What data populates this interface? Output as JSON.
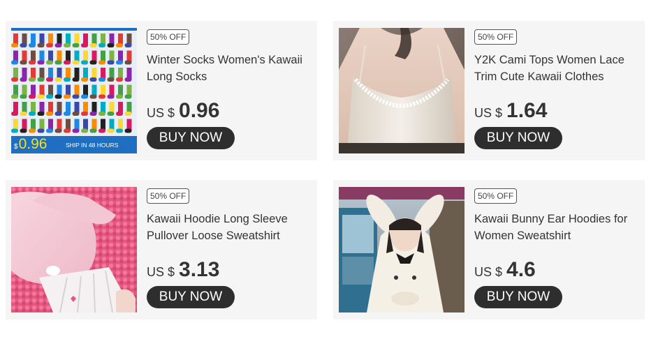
{
  "products": [
    {
      "badge": "50% OFF",
      "title": "Winter Socks Women's Kawaii Long Socks",
      "currency": "US $",
      "price": "0.96",
      "button": "BUY NOW",
      "image": {
        "banner_price_symbol": "$",
        "banner_price": "0.96",
        "banner_text": "SHIP IN 48 HOURS"
      }
    },
    {
      "badge": "50% OFF",
      "title": "Y2K Cami Tops Women Lace Trim Cute Kawaii Clothes",
      "currency": "US $",
      "price": "1.64",
      "button": "BUY NOW"
    },
    {
      "badge": "50% OFF",
      "title": "Kawaii Hoodie Long Sleeve Pullover Loose Sweatshirt",
      "currency": "US $",
      "price": "3.13",
      "button": "BUY NOW"
    },
    {
      "badge": "50% OFF",
      "title": "Kawaii Bunny Ear Hoodies for Women Sweatshirt",
      "currency": "US $",
      "price": "4.6",
      "button": "BUY NOW"
    }
  ],
  "colors": {
    "card_bg": "#f5f5f5",
    "button_bg": "#2e2e2e",
    "banner_blue": "#1e6fc2",
    "banner_price": "#f7e418"
  }
}
